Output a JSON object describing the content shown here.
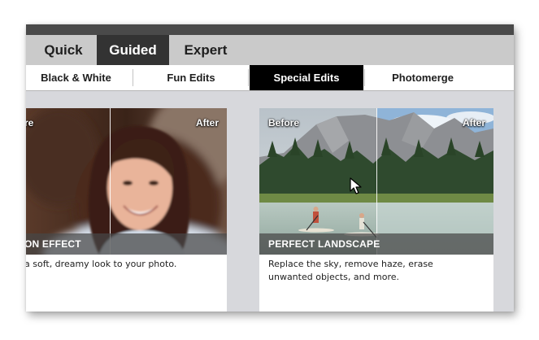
{
  "mode_tabs": [
    {
      "label": "Quick",
      "active": false
    },
    {
      "label": "Guided",
      "active": true
    },
    {
      "label": "Expert",
      "active": false
    }
  ],
  "sub_tabs": [
    {
      "label": "Black & White",
      "active": false
    },
    {
      "label": "Fun Edits",
      "active": false
    },
    {
      "label": "Special Edits",
      "active": true
    },
    {
      "label": "Photomerge",
      "active": false
    }
  ],
  "cards": [
    {
      "before_label": "re",
      "after_label": "After",
      "title": "ON EFFECT",
      "description": "a soft, dreamy look to your photo."
    },
    {
      "before_label": "Before",
      "after_label": "After",
      "title": "PERFECT LANDSCAPE",
      "description": "Replace the sky, remove haze, erase unwanted objects, and more."
    }
  ],
  "icons": {
    "cursor": "mouse-pointer-icon"
  },
  "colors": {
    "active_tab_bg": "#333333",
    "active_subtab_bg": "#000000",
    "workspace_bg": "#d7d8dc"
  }
}
